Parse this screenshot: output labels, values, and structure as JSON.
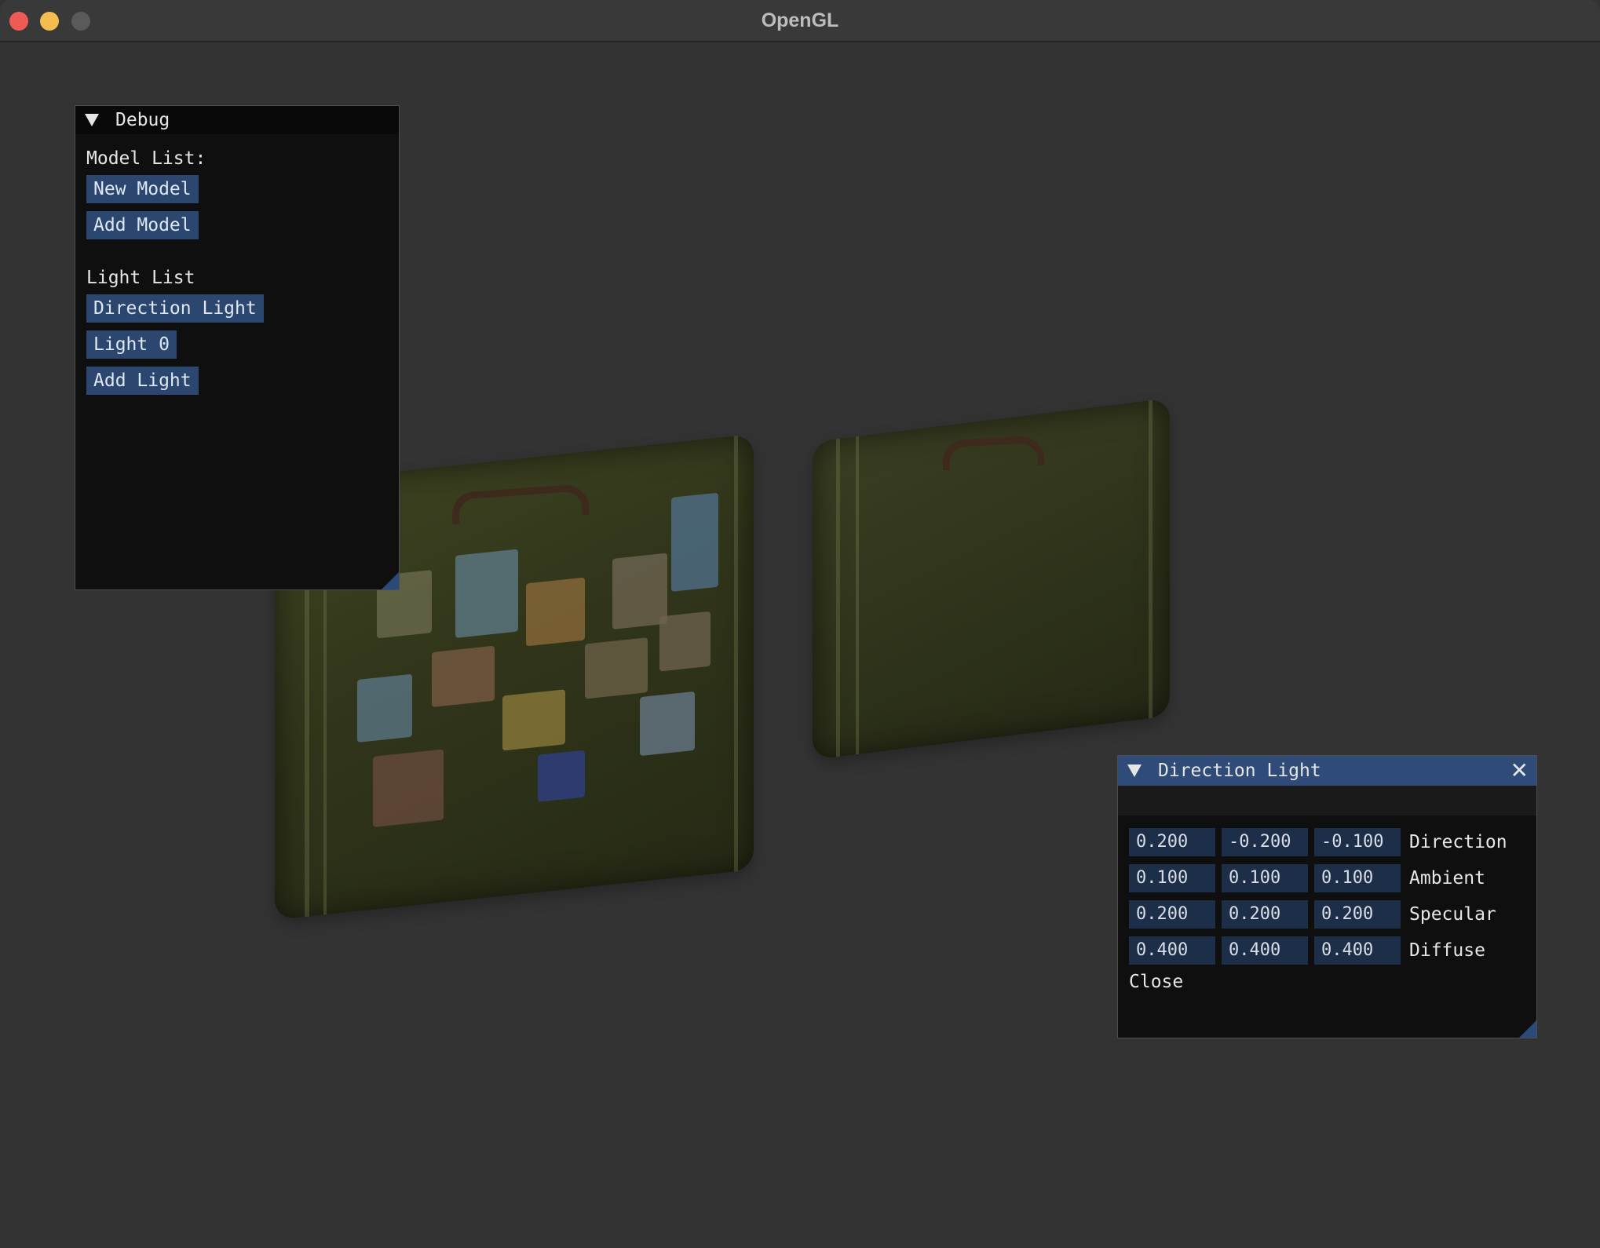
{
  "window": {
    "title": "OpenGL"
  },
  "debug_panel": {
    "title": "Debug",
    "model_list_label": "Model List:",
    "model_buttons": [
      "New Model",
      "Add Model"
    ],
    "light_list_label": "Light List",
    "light_buttons": [
      "Direction Light",
      "Light 0",
      "Add Light"
    ]
  },
  "direction_light_panel": {
    "title": "Direction Light",
    "close_glyph": "✕",
    "rows": [
      {
        "label": "Direction",
        "values": [
          "0.200",
          "-0.200",
          "-0.100"
        ]
      },
      {
        "label": "Ambient",
        "values": [
          "0.100",
          "0.100",
          "0.100"
        ]
      },
      {
        "label": "Specular",
        "values": [
          "0.200",
          "0.200",
          "0.200"
        ]
      },
      {
        "label": "Diffuse",
        "values": [
          "0.400",
          "0.400",
          "0.400"
        ]
      }
    ],
    "close_label": "Close"
  },
  "colors": {
    "background": "#333333",
    "panel_bg": "#0f0f0f",
    "button_bg": "#2b4770",
    "field_bg": "#1d2e48",
    "active_title_bg": "#2f4b78"
  }
}
